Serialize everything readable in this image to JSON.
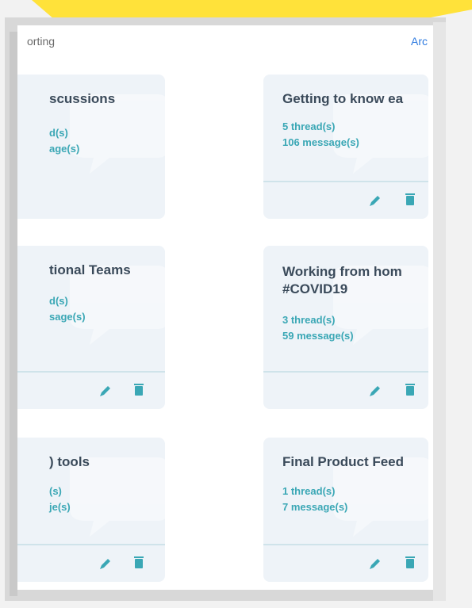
{
  "header": {
    "left_label": "orting",
    "right_label": "Arc"
  },
  "cards": [
    {
      "title": "scussions",
      "threads": "d(s)",
      "messages": "age(s)"
    },
    {
      "title": "Getting to know ea",
      "threads": "5 thread(s)",
      "messages": "106 message(s)"
    },
    {
      "title": "tional Teams",
      "threads": "d(s)",
      "messages": "sage(s)"
    },
    {
      "title_line1": "Working from hom",
      "title_line2": "#COVID19",
      "threads": "3 thread(s)",
      "messages": "59 message(s)"
    },
    {
      "title": ") tools",
      "threads": "(s)",
      "messages": "je(s)"
    },
    {
      "title": "Final Product Feed",
      "threads": "1 thread(s)",
      "messages": "7 message(s)"
    }
  ],
  "colors": {
    "accent": "#2f7be0",
    "teal": "#3aa7b5",
    "card_bg": "#eef3f8",
    "yellow": "#ffe23a"
  },
  "icons": {
    "edit": "pencil-icon",
    "delete": "trash-icon"
  }
}
